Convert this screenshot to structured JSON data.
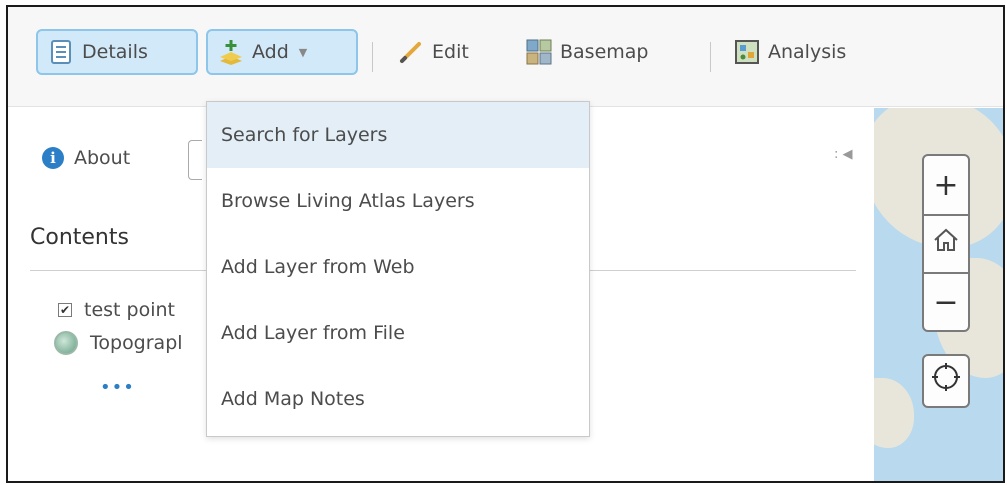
{
  "toolbar": {
    "details_label": "Details",
    "add_label": "Add",
    "edit_label": "Edit",
    "basemap_label": "Basemap",
    "analysis_label": "Analysis"
  },
  "panel": {
    "about_label": "About",
    "contents_title": "Contents",
    "layers": [
      {
        "label": "test point",
        "checked": true
      },
      {
        "label": "Topograpl",
        "type": "basemap"
      }
    ],
    "more_label": "•••"
  },
  "add_menu": {
    "items": [
      {
        "label": "Search for Layers",
        "active": true
      },
      {
        "label": "Browse Living Atlas Layers"
      },
      {
        "label": "Add Layer from Web"
      },
      {
        "label": "Add Layer from File"
      },
      {
        "label": "Add Map Notes"
      }
    ]
  },
  "map_controls": {
    "zoom_in": "+",
    "zoom_out": "−"
  },
  "colors": {
    "selected_bg": "#d2e9f9",
    "selected_border": "#8dc6ea",
    "active_item_bg": "#e3eef7",
    "info_blue": "#2c7fc7"
  }
}
